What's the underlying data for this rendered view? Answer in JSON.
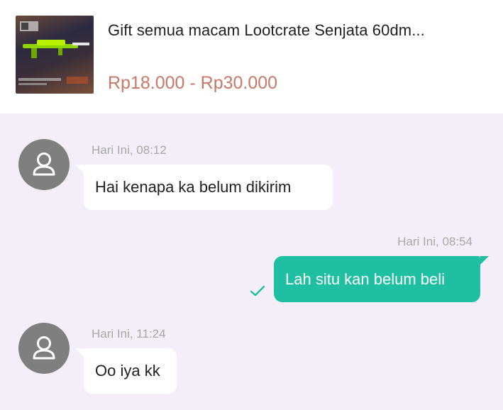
{
  "product": {
    "title": "Gift semua macam Lootcrate Senjata 60dm...",
    "price": "Rp18.000 - Rp30.000",
    "thumbnail_icon": "game-weapon-thumbnail"
  },
  "messages": [
    {
      "direction": "incoming",
      "time": "Hari Ini, 08:12",
      "text": "Hai kenapa ka belum dikirim"
    },
    {
      "direction": "outgoing",
      "time": "Hari Ini, 08:54",
      "text": "Lah situ kan belum beli",
      "status_icon": "check-icon"
    },
    {
      "direction": "incoming",
      "time": "Hari Ini, 11:24",
      "text": "Oo iya kk"
    }
  ],
  "colors": {
    "background": "#f3eef7",
    "price": "#c97867",
    "outgoing_bubble": "#1fbfa1",
    "incoming_bubble": "#ffffff",
    "avatar": "#7f7f7f",
    "timestamp": "#a8a8a8"
  }
}
